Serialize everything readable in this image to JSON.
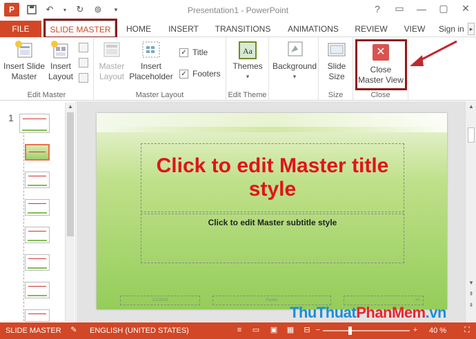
{
  "window": {
    "title": "Presentation1 - PowerPoint",
    "buttons": {
      "help": "?",
      "minimize": "—",
      "restore": "▢",
      "close": "✕"
    }
  },
  "qat": {
    "logo": "P"
  },
  "tabs": [
    {
      "label": "FILE"
    },
    {
      "label": "SLIDE MASTER"
    },
    {
      "label": "HOME"
    },
    {
      "label": "INSERT"
    },
    {
      "label": "TRANSITIONS"
    },
    {
      "label": "ANIMATIONS"
    },
    {
      "label": "REVIEW"
    },
    {
      "label": "VIEW"
    },
    {
      "label": "Sign in"
    }
  ],
  "ribbon": {
    "edit_master": {
      "label": "Edit Master",
      "insert_slide_master": "Insert Slide\nMaster",
      "insert_layout": "Insert\nLayout"
    },
    "master_layout": {
      "label": "Master Layout",
      "master_layout_btn": "Master\nLayout",
      "insert_placeholder": "Insert\nPlaceholder",
      "title_check": "Title",
      "footers_check": "Footers"
    },
    "edit_theme": {
      "label": "Edit Theme",
      "themes": "Themes"
    },
    "background": {
      "label": "",
      "background": "Background"
    },
    "size": {
      "label": "Size",
      "slide_size": "Slide\nSize"
    },
    "close": {
      "label": "Close",
      "close_master_view": "Close\nMaster View"
    }
  },
  "thumbnails": {
    "first_number": "1"
  },
  "slide": {
    "title": "Click to edit Master title style",
    "subtitle": "Click to edit Master subtitle style",
    "footer_date": "1/1/2016",
    "footer_text": "Footer",
    "footer_num": "‹#›"
  },
  "status": {
    "mode": "SLIDE MASTER",
    "language": "ENGLISH (UNITED STATES)",
    "zoom": "40 %"
  },
  "watermark": {
    "part1": "ThuThuat",
    "part2": "PhanMem",
    "part3": ".vn"
  },
  "colors": {
    "accent": "#d24726",
    "highlight": "#8b1a1a",
    "title_red": "#e0141b"
  }
}
